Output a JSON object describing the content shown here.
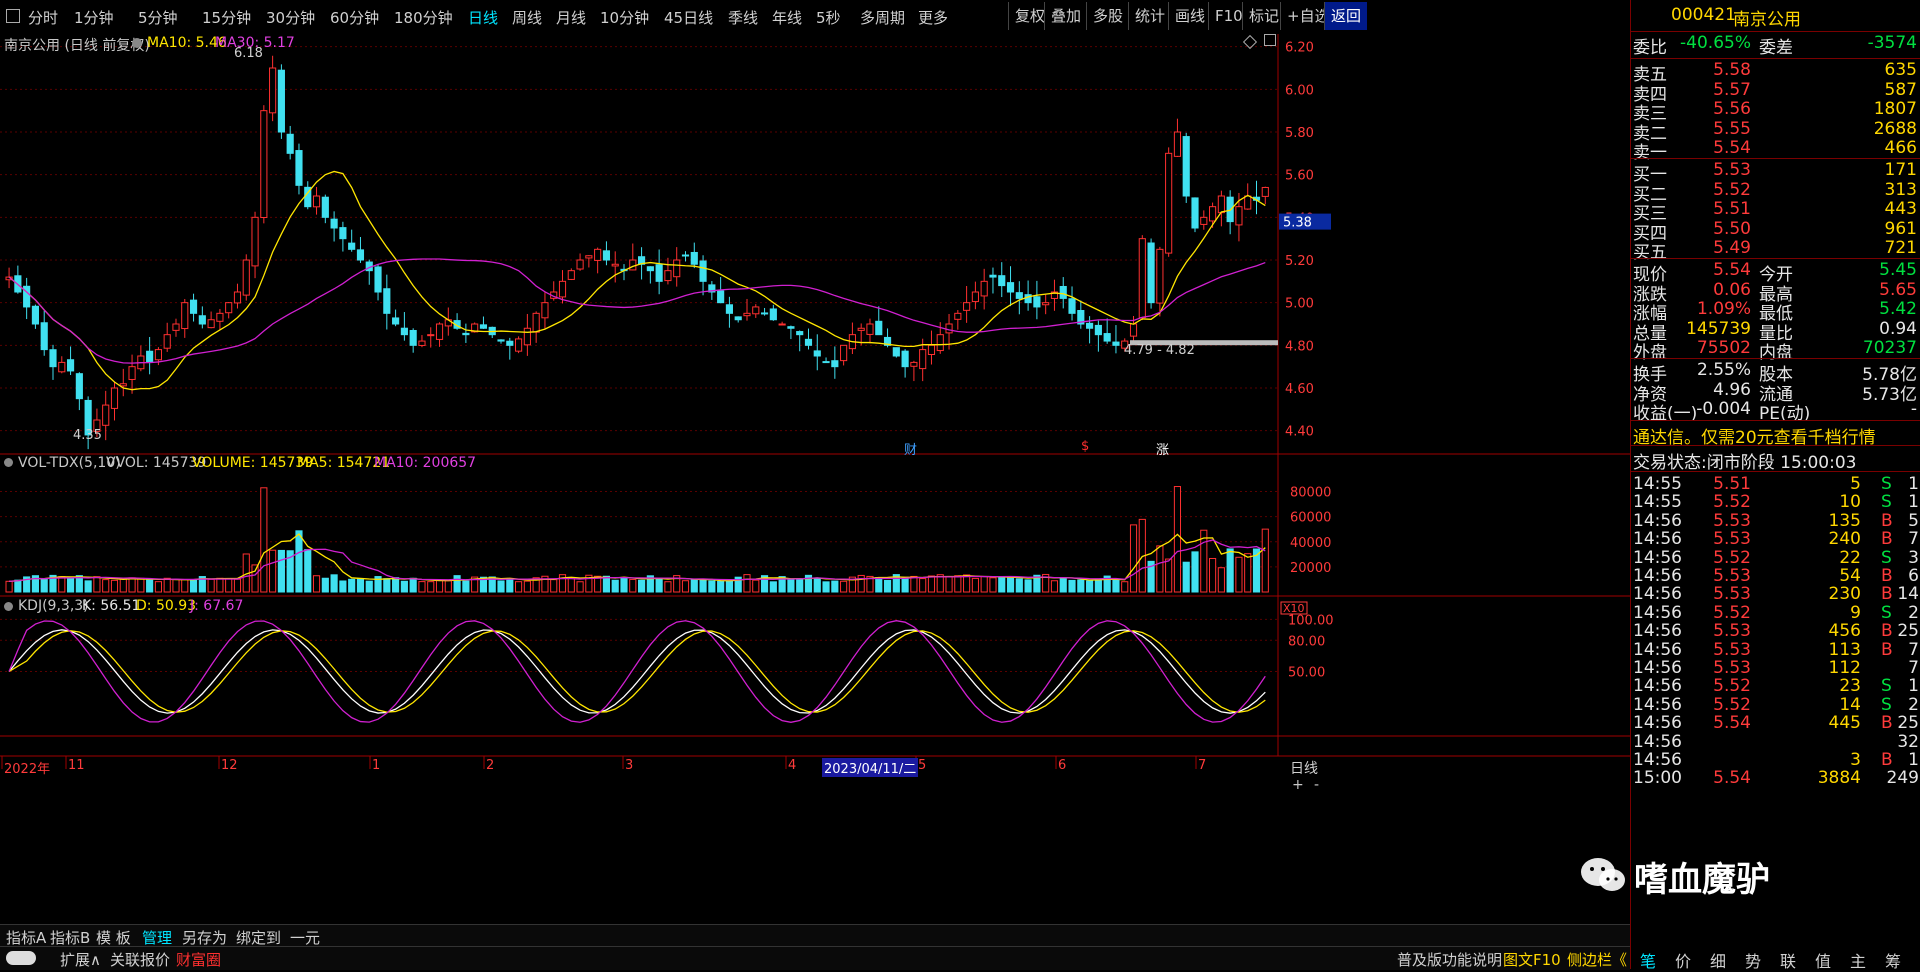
{
  "toolbar": {
    "left_icon": "window-icon",
    "periods": [
      "分时",
      "1分钟",
      "5分钟",
      "15分钟",
      "30分钟",
      "60分钟",
      "180分钟",
      "日线",
      "周线",
      "月线",
      "10分钟",
      "45日线",
      "季线",
      "年线",
      "5秒",
      "多周期",
      "更多"
    ],
    "active_period": "日线",
    "right_items": [
      "复权",
      "叠加",
      "多股",
      "统计",
      "画线",
      "F10",
      "标记",
      "+自选",
      "返回"
    ]
  },
  "chart_header": {
    "title": "南京公用 (日线 前复权)",
    "ma10": "MA10: 5.46",
    "ma30": "MA30: 5.17"
  },
  "price_axis": [
    "6.20",
    "6.00",
    "5.80",
    "5.60",
    "5.40",
    "5.20",
    "5.00",
    "4.80",
    "4.60",
    "4.40"
  ],
  "current_price_marker": "5.38",
  "annotations": {
    "high": "6.18",
    "low": "4.35",
    "range": "4.79 - 4.82",
    "event_cai": "财",
    "event_s": "$",
    "event_zhang": "涨"
  },
  "vol_header": {
    "name": "VOL-TDX(5,10)",
    "vvol": "VVOL: 145739",
    "volume": "VOLUME: 145739",
    "ma5": "MA5: 154721",
    "ma10": "MA10: 200657"
  },
  "vol_axis": [
    "80000",
    "60000",
    "40000",
    "20000"
  ],
  "vol_unit": "X10",
  "kdj_header": {
    "name": "KDJ(9,3,3)",
    "k": "K: 56.51",
    "d": "D: 50.93",
    "j": "J: 67.67"
  },
  "kdj_axis": [
    "100.00",
    "80.00",
    "50.00"
  ],
  "time_axis": [
    {
      "label": "2022年"
    },
    {
      "label": "11"
    },
    {
      "label": "12"
    },
    {
      "label": "1"
    },
    {
      "label": "2"
    },
    {
      "label": "3"
    },
    {
      "label": "4"
    },
    {
      "label": "2023/04/11/二"
    },
    {
      "label": "5"
    },
    {
      "label": "6"
    },
    {
      "label": "7"
    }
  ],
  "axis_mode": "日线",
  "bottom_bar1": [
    "指标A",
    "指标B",
    "模 板",
    "管理",
    "另存为",
    "绑定到",
    "一元"
  ],
  "bottom_bar2": [
    "扩展∧",
    "关联报价",
    "财富圈"
  ],
  "bottom_right": [
    "普及版功能说明",
    "图文F10",
    "侧边栏《"
  ],
  "stock": {
    "code": "000421",
    "name": "南京公用",
    "weibi_label": "委比",
    "weibi": "-40.65%",
    "weicha_label": "委差",
    "weicha": "-3574",
    "sell": [
      {
        "label": "卖五",
        "price": "5.58",
        "vol": "635"
      },
      {
        "label": "卖四",
        "price": "5.57",
        "vol": "587"
      },
      {
        "label": "卖三",
        "price": "5.56",
        "vol": "1807"
      },
      {
        "label": "卖二",
        "price": "5.55",
        "vol": "2688"
      },
      {
        "label": "卖一",
        "price": "5.54",
        "vol": "466"
      }
    ],
    "buy": [
      {
        "label": "买一",
        "price": "5.53",
        "vol": "171"
      },
      {
        "label": "买二",
        "price": "5.52",
        "vol": "313"
      },
      {
        "label": "买三",
        "price": "5.51",
        "vol": "443"
      },
      {
        "label": "买四",
        "price": "5.50",
        "vol": "961"
      },
      {
        "label": "买五",
        "price": "5.49",
        "vol": "721"
      }
    ],
    "quote": [
      {
        "l1": "现价",
        "v1": "5.54",
        "l2": "今开",
        "v2": "5.45"
      },
      {
        "l1": "涨跌",
        "v1": "0.06",
        "l2": "最高",
        "v2": "5.65"
      },
      {
        "l1": "涨幅",
        "v1": "1.09%",
        "l2": "最低",
        "v2": "5.42"
      },
      {
        "l1": "总量",
        "v1": "145739",
        "l2": "量比",
        "v2": "0.94"
      },
      {
        "l1": "外盘",
        "v1": "75502",
        "l2": "内盘",
        "v2": "70237"
      }
    ],
    "info": [
      {
        "l1": "换手",
        "v1": "2.55%",
        "l2": "股本",
        "v2": "5.78亿"
      },
      {
        "l1": "净资",
        "v1": "4.96",
        "l2": "流通",
        "v2": "5.73亿"
      },
      {
        "l1": "收益(一)",
        "v1": "-0.004",
        "l2": "PE(动)",
        "v2": "-"
      }
    ],
    "promo": "通达信。仅需20元查看千档行情",
    "trade_status": "交易状态:闭市阶段 15:00:03",
    "ticks": [
      {
        "t": "14:55",
        "p": "5.51",
        "v": "5",
        "s": "S",
        "n": "1"
      },
      {
        "t": "14:55",
        "p": "5.52",
        "v": "10",
        "s": "S",
        "n": "1"
      },
      {
        "t": "14:56",
        "p": "5.53",
        "v": "135",
        "s": "B",
        "n": "5"
      },
      {
        "t": "14:56",
        "p": "5.53",
        "v": "240",
        "s": "B",
        "n": "7"
      },
      {
        "t": "14:56",
        "p": "5.52",
        "v": "22",
        "s": "S",
        "n": "3"
      },
      {
        "t": "14:56",
        "p": "5.53",
        "v": "54",
        "s": "B",
        "n": "6"
      },
      {
        "t": "14:56",
        "p": "5.53",
        "v": "230",
        "s": "B",
        "n": "14"
      },
      {
        "t": "14:56",
        "p": "5.52",
        "v": "9",
        "s": "S",
        "n": "2"
      },
      {
        "t": "14:56",
        "p": "5.53",
        "v": "456",
        "s": "B",
        "n": "25"
      },
      {
        "t": "14:56",
        "p": "5.53",
        "v": "113",
        "s": "B",
        "n": "7"
      },
      {
        "t": "14:56",
        "p": "5.53",
        "v": "112",
        "s": "",
        "n": "7"
      },
      {
        "t": "14:56",
        "p": "5.52",
        "v": "23",
        "s": "S",
        "n": "1"
      },
      {
        "t": "14:56",
        "p": "5.52",
        "v": "14",
        "s": "S",
        "n": "2"
      },
      {
        "t": "14:56",
        "p": "5.54",
        "v": "445",
        "s": "B",
        "n": "25"
      },
      {
        "t": "14:56",
        "p": "",
        "v": "",
        "s": "",
        "n": "32"
      },
      {
        "t": "14:56",
        "p": "",
        "v": "3",
        "s": "B",
        "n": "1"
      },
      {
        "t": "15:00",
        "p": "5.54",
        "v": "3884",
        "s": "",
        "n": "249"
      }
    ],
    "bottom_tabs": [
      "笔",
      "价",
      "细",
      "势",
      "联",
      "值",
      "主",
      "筹"
    ],
    "plus": "+",
    "minus": "-"
  },
  "watermark": "嗜血魔驴",
  "chart_data": {
    "type": "candlestick",
    "title": "南京公用 (日线 前复权)",
    "ylim": [
      4.3,
      6.25
    ],
    "x_labels": [
      "2022年",
      "11",
      "12",
      "1",
      "2",
      "3",
      "4",
      "5",
      "6",
      "7"
    ],
    "high_label": 6.18,
    "low_label": 4.35,
    "last_close": 5.54,
    "close_series": [
      5.12,
      5.05,
      4.98,
      4.9,
      4.78,
      4.7,
      4.72,
      4.68,
      4.55,
      4.38,
      4.45,
      4.52,
      4.6,
      4.62,
      4.7,
      4.75,
      4.72,
      4.78,
      4.85,
      4.9,
      5.0,
      4.95,
      4.9,
      4.92,
      4.95,
      5.0,
      5.05,
      5.2,
      5.4,
      5.9,
      6.1,
      5.8,
      5.7,
      5.55,
      5.45,
      5.5,
      5.4,
      5.35,
      5.3,
      5.25,
      5.2,
      5.15,
      5.05,
      4.95,
      4.9,
      4.85,
      4.8,
      4.82,
      4.85,
      4.9,
      4.92,
      4.88,
      4.85,
      4.9,
      4.88,
      4.85,
      4.82,
      4.8,
      4.83,
      4.88,
      4.95,
      5.0,
      5.05,
      5.1,
      5.15,
      5.2,
      5.22,
      5.25,
      5.2,
      5.18,
      5.15,
      5.2,
      5.18,
      5.15,
      5.1,
      5.15,
      5.2,
      5.22,
      5.18,
      5.1,
      5.05,
      5.0,
      4.95,
      4.92,
      4.95,
      4.98,
      4.95,
      4.92,
      4.9,
      4.88,
      4.85,
      4.8,
      4.75,
      4.72,
      4.7,
      4.8,
      4.85,
      4.88,
      4.9,
      4.85,
      4.8,
      4.75,
      4.7,
      4.72,
      4.78,
      4.8,
      4.85,
      4.9,
      4.95,
      5.0,
      5.05,
      5.1,
      5.12,
      5.08,
      5.05,
      5.02,
      5.0,
      4.98,
      5.0,
      5.05,
      5.02,
      4.95,
      4.9,
      4.88,
      4.85,
      4.82,
      4.8,
      4.82,
      4.9,
      5.3,
      5.0,
      5.25,
      5.7,
      5.8,
      5.5,
      5.35,
      5.4,
      5.45,
      5.5,
      5.38,
      5.45,
      5.5,
      5.48,
      5.54
    ],
    "ma10": 5.46,
    "ma30": 5.17,
    "volume": {
      "last": 145739,
      "ma5": 154721,
      "ma10": 200657,
      "ylim": [
        0,
        90000
      ]
    },
    "kdj": {
      "k": 56.51,
      "d": 50.93,
      "j": 67.67
    }
  }
}
